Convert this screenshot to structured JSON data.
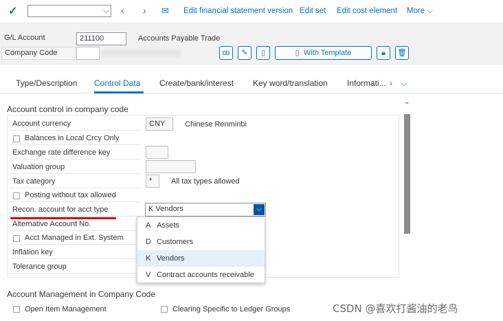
{
  "toolbar": {
    "links": [
      "Edit financial statement version",
      "Edit set",
      "Edit cost element",
      "More"
    ],
    "cmd_value": ""
  },
  "header": {
    "gl_account_label": "G/L Account",
    "gl_account_value": "211100",
    "gl_account_desc": "Accounts Payable Trade",
    "company_code_label": "Company Code",
    "company_code_value": "",
    "with_template_label": "With Template"
  },
  "tabs": [
    "Type/Description",
    "Control Data",
    "Create/bank/interest",
    "Key word/translation",
    "Informati..."
  ],
  "active_tab": "Control Data",
  "section1": {
    "title": "Account control in company code",
    "account_currency_label": "Account currency",
    "account_currency_value": "CNY",
    "account_currency_desc": "Chinese Renminbi",
    "local_crcy_label": "Balances in Local Crcy Only",
    "exch_rate_label": "Exchange rate difference key",
    "valuation_group_label": "Valuation group",
    "tax_category_label": "Tax category",
    "tax_category_value": "*",
    "tax_category_desc": "All tax types allowed",
    "posting_no_tax_label": "Posting without tax allowed",
    "recon_label": "Recon. account for acct type",
    "recon_value": "K Vendors",
    "alt_account_label": "Alternative Account No.",
    "acct_managed_label": "Acct Managed in Ext. System",
    "inflation_label": "Inflation key",
    "tolerance_label": "Tolerance group"
  },
  "dropdown_options": [
    {
      "key": "A",
      "text": "Assets"
    },
    {
      "key": "D",
      "text": "Customers"
    },
    {
      "key": "K",
      "text": "Vendors"
    },
    {
      "key": "V",
      "text": "Contract accounts receivable"
    }
  ],
  "selected_option_key": "K",
  "section2": {
    "title": "Account Management in Company Code",
    "open_item_label": "Open Item Management",
    "clearing_label": "Clearing Specific to Ledger Groups"
  },
  "watermark": "CSDN @喜欢打酱油的老鸟",
  "colors": {
    "accent": "#0a6ed1",
    "confirm": "#107e3e",
    "annotation": "#d40000"
  }
}
